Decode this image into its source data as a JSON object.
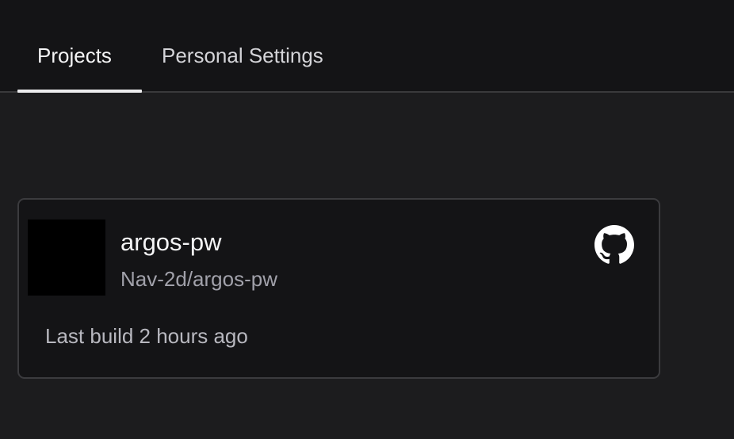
{
  "tabs": [
    {
      "label": "Projects",
      "active": true
    },
    {
      "label": "Personal Settings",
      "active": false
    }
  ],
  "project": {
    "name": "argos-pw",
    "slug": "Nav-2d/argos-pw",
    "last_build": "Last build 2 hours ago",
    "provider_icon": "github-icon"
  },
  "colors": {
    "background": "#1c1c1e",
    "header_background": "#141416",
    "card_background": "#141416",
    "card_border": "#3b3b3e",
    "active_tab_indicator": "#ececee"
  }
}
